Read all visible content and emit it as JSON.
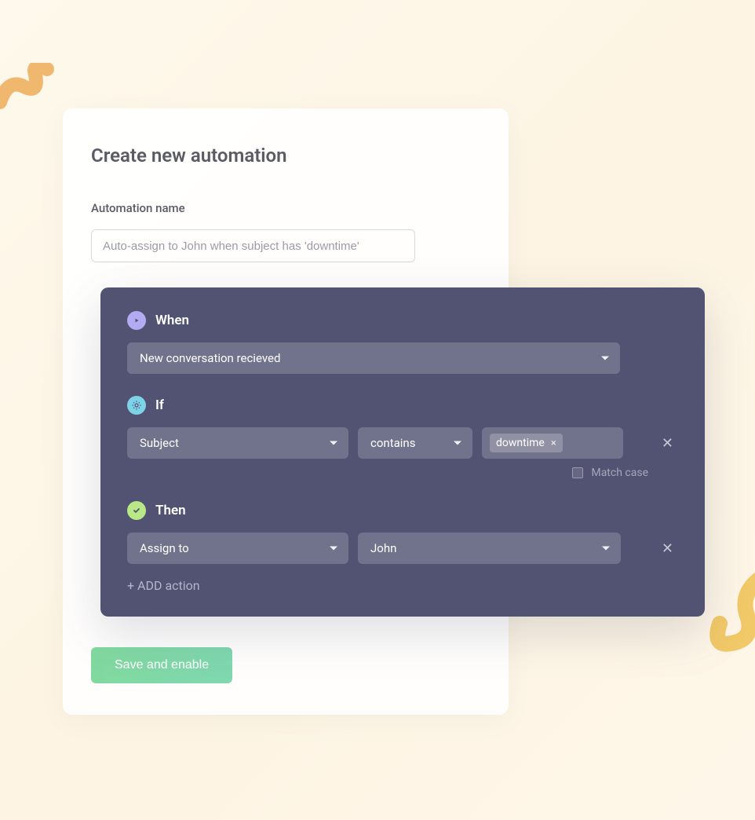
{
  "card": {
    "title": "Create new automation",
    "name_label": "Automation name",
    "name_placeholder": "Auto-assign to John when subject has 'downtime'",
    "save_label": "Save and enable"
  },
  "rule": {
    "when": {
      "label": "When",
      "trigger": "New conversation recieved"
    },
    "if": {
      "label": "If",
      "field": "Subject",
      "operator": "contains",
      "value_tag": "downtime",
      "match_case_label": "Match case"
    },
    "then": {
      "label": "Then",
      "action": "Assign to",
      "target": "John",
      "add_action_label": "+ ADD action"
    }
  }
}
